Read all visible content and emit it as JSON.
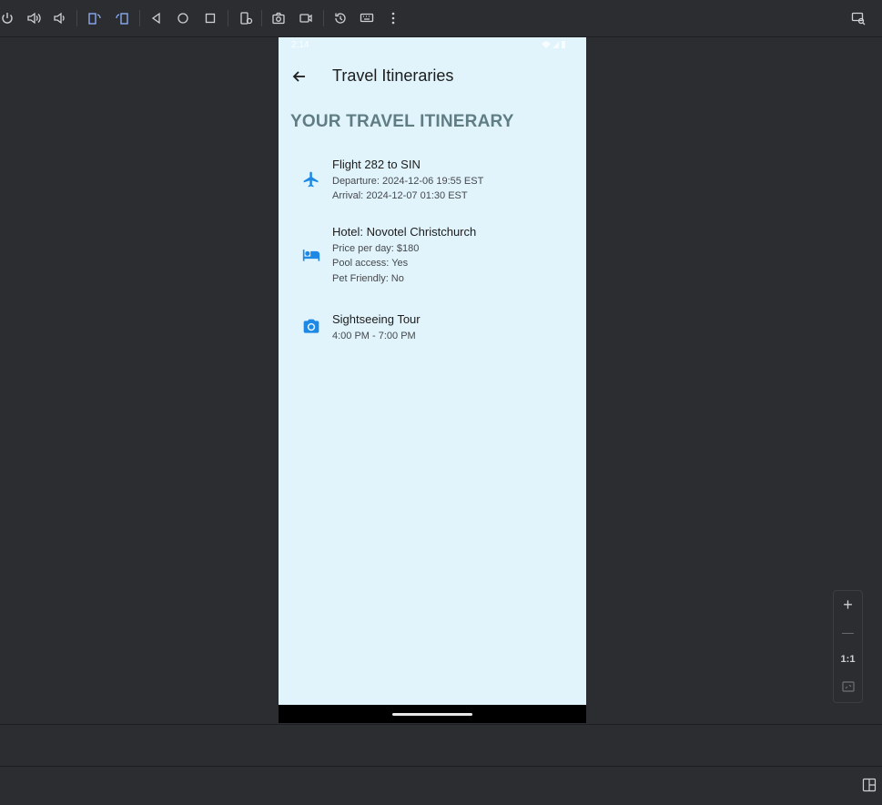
{
  "app": {
    "title": "Travel Itineraries",
    "heading": "YOUR TRAVEL ITINERARY",
    "accent_color": "#1e88e5",
    "background_color": "#e1f4fc",
    "heading_color": "#607d84"
  },
  "statusbar": {
    "time": "2:14",
    "icons": [
      "wifi-icon",
      "signal-icon",
      "battery-icon"
    ]
  },
  "itinerary": [
    {
      "icon": "airplane-icon",
      "title": "Flight 282 to SIN",
      "lines": [
        "Departure: 2024-12-06 19:55 EST",
        "Arrival: 2024-12-07 01:30 EST"
      ]
    },
    {
      "icon": "hotel-bed-icon",
      "title": "Hotel: Novotel Christchurch",
      "lines": [
        "Price per day: $180",
        "Pool access: Yes",
        "Pet Friendly: No"
      ]
    },
    {
      "icon": "camera-icon",
      "title": "Sightseeing Tour",
      "lines": [
        "4:00 PM - 7:00 PM"
      ]
    }
  ],
  "zoom": {
    "plus": "+",
    "minus": "—",
    "reset": "1:1"
  }
}
